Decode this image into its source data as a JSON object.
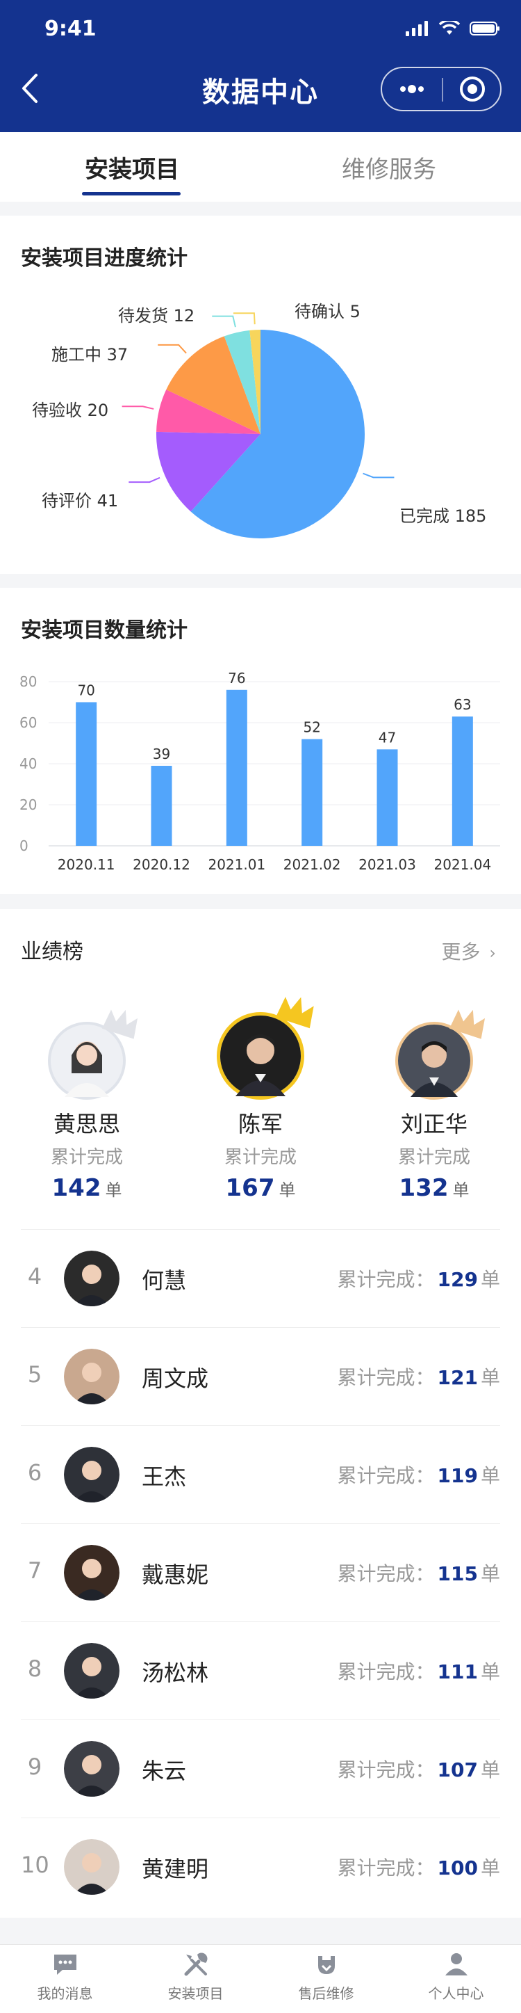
{
  "status": {
    "time": "9:41"
  },
  "header": {
    "title": "数据中心"
  },
  "tabs": [
    {
      "label": "安装项目"
    },
    {
      "label": "维修服务"
    }
  ],
  "pie_section": {
    "title": "安装项目进度统计"
  },
  "bar_section": {
    "title": "安装项目数量统计"
  },
  "colors": {
    "primary": "#14338f",
    "bar": "#52a5fb"
  },
  "chart_data": [
    {
      "type": "pie",
      "title": "安装项目进度统计",
      "slices": [
        {
          "label": "已完成",
          "value": 185,
          "color": "#52a5fb"
        },
        {
          "label": "待评价",
          "value": 41,
          "color": "#a45cfd"
        },
        {
          "label": "待验收",
          "value": 20,
          "color": "#ff5aa8"
        },
        {
          "label": "施工中",
          "value": 37,
          "color": "#fd9a47"
        },
        {
          "label": "待发货",
          "value": 12,
          "color": "#7fe0e0"
        },
        {
          "label": "待确认",
          "value": 5,
          "color": "#f7d55c"
        }
      ],
      "labels_text": [
        "已完成 185",
        "待评价 41",
        "待验收 20",
        "施工中 37",
        "待发货 12",
        "待确认 5"
      ]
    },
    {
      "type": "bar",
      "title": "安装项目数量统计",
      "categories": [
        "2020.11",
        "2020.12",
        "2021.01",
        "2021.02",
        "2021.03",
        "2021.04"
      ],
      "values": [
        70,
        39,
        76,
        52,
        47,
        63
      ],
      "ylim": [
        0,
        80
      ],
      "yticks": [
        "0",
        "20",
        "40",
        "60",
        "80"
      ],
      "grid": true
    }
  ],
  "ranking": {
    "title": "业绩榜",
    "more": "更多",
    "sub_label": "累计完成",
    "unit": "单",
    "row_prefix": "累计完成：",
    "podium": [
      {
        "place": 2,
        "name": "黄思思",
        "count": "142"
      },
      {
        "place": 1,
        "name": "陈军",
        "count": "167"
      },
      {
        "place": 3,
        "name": "刘正华",
        "count": "132"
      }
    ],
    "rows": [
      {
        "rank": "4",
        "name": "何慧",
        "count": "129"
      },
      {
        "rank": "5",
        "name": "周文成",
        "count": "121"
      },
      {
        "rank": "6",
        "name": "王杰",
        "count": "119"
      },
      {
        "rank": "7",
        "name": "戴惠妮",
        "count": "115"
      },
      {
        "rank": "8",
        "name": "汤松林",
        "count": "111"
      },
      {
        "rank": "9",
        "name": "朱云",
        "count": "107"
      },
      {
        "rank": "10",
        "name": "黄建明",
        "count": "100"
      }
    ]
  },
  "tabbar": [
    {
      "label": "我的消息",
      "icon": "message-icon"
    },
    {
      "label": "安装项目",
      "icon": "tools-icon"
    },
    {
      "label": "售后维修",
      "icon": "repair-icon"
    },
    {
      "label": "个人中心",
      "icon": "user-icon"
    }
  ]
}
